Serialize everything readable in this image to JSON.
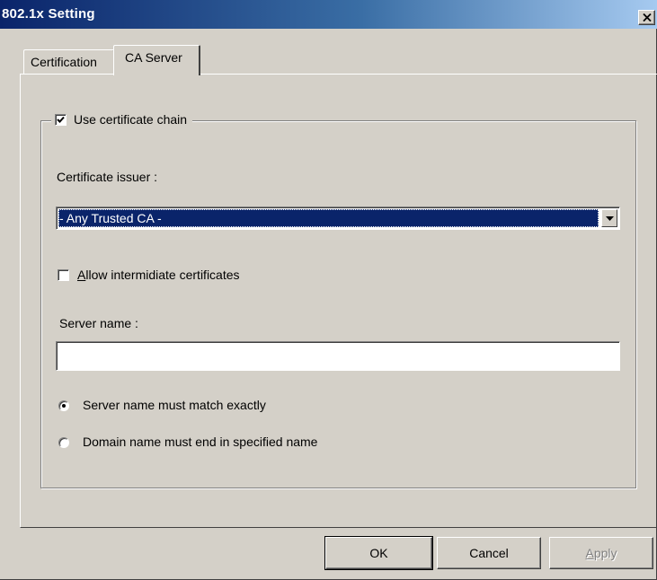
{
  "window": {
    "title": "802.1x Setting"
  },
  "tabs": [
    {
      "label": "Certification",
      "active": false
    },
    {
      "label": "CA Server",
      "active": true
    }
  ],
  "certificate_chain": {
    "label": "Use certificate chain",
    "checked": true
  },
  "issuer": {
    "label": "Certificate issuer :",
    "selected": "- Any Trusted CA -"
  },
  "intermediate": {
    "label_mnemonic": "A",
    "label_rest": "llow intermidiate certificates",
    "checked": false
  },
  "server": {
    "label": "Server name :",
    "value": "",
    "placeholder": ""
  },
  "match": {
    "exact_label": "Server name must match exactly",
    "domain_label": "Domain name must end in specified name",
    "selected": "exact"
  },
  "buttons": {
    "ok": "OK",
    "cancel": "Cancel",
    "apply_mnemonic": "A",
    "apply_rest": "pply",
    "apply_enabled": false
  },
  "colors": {
    "face": "#d4d0c8",
    "titlebar_start": "#0a246a",
    "titlebar_end": "#a6caf0",
    "selection": "#0a246a"
  }
}
